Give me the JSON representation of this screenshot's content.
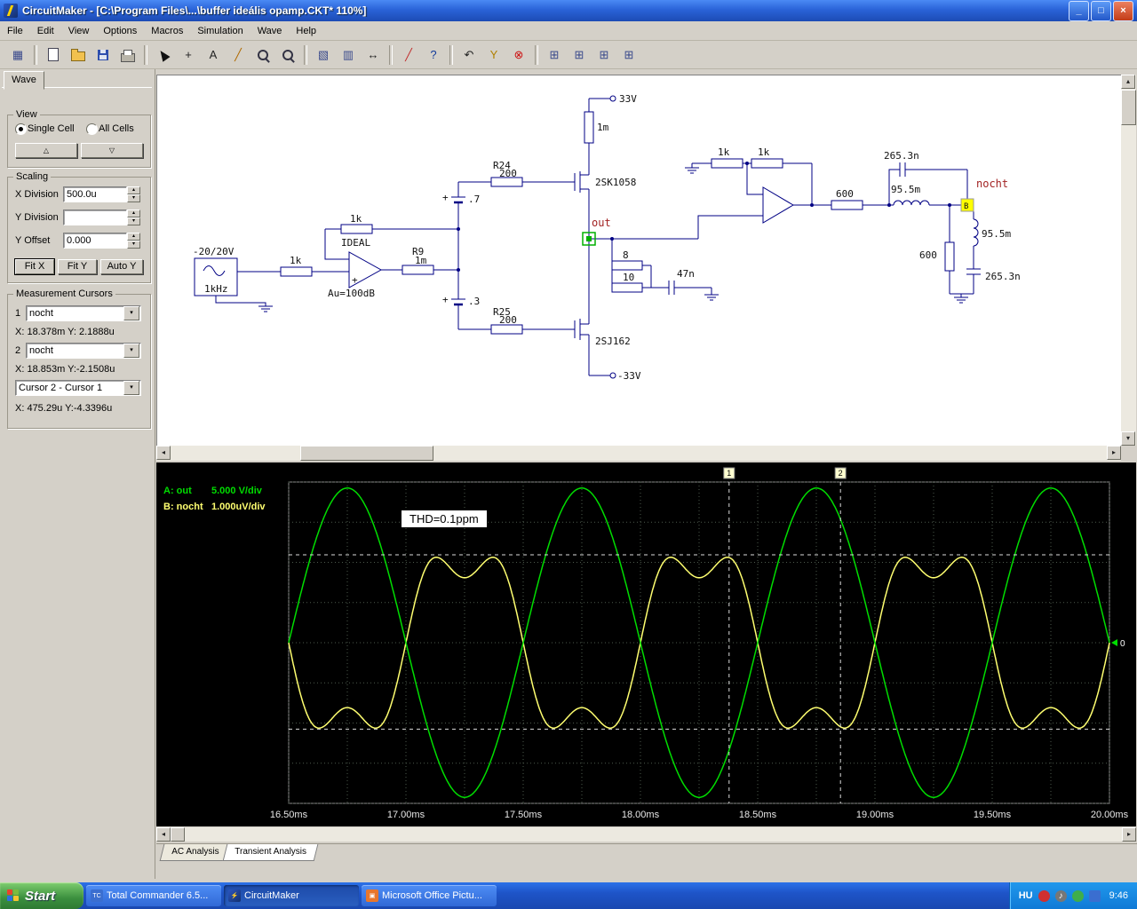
{
  "window": {
    "title": "CircuitMaker - [C:\\Program Files\\...\\buffer ideális opamp.CKT* 110%]",
    "controls": {
      "minimize": "_",
      "maximize": "□",
      "close": "×"
    },
    "menus": [
      "File",
      "Edit",
      "View",
      "Options",
      "Macros",
      "Simulation",
      "Wave",
      "Help"
    ]
  },
  "toolbar": {
    "buttons": [
      {
        "name": "pcb-board",
        "glyph": "▦",
        "color": "#3a4a8c"
      },
      {
        "type": "sep"
      },
      {
        "name": "new-file",
        "cls": "ic-page"
      },
      {
        "name": "open-file",
        "cls": "ic-folder"
      },
      {
        "name": "save-file",
        "cls": "ic-save"
      },
      {
        "name": "print",
        "cls": "ic-print"
      },
      {
        "type": "sep"
      },
      {
        "name": "select-tool",
        "cls": "ic-cursorarrow"
      },
      {
        "name": "add-part",
        "glyph": "+",
        "color": "#222"
      },
      {
        "name": "text-tool",
        "glyph": "A",
        "color": "#222"
      },
      {
        "name": "probe-tool",
        "glyph": "╱",
        "color": "#b06a00"
      },
      {
        "name": "zoom-in",
        "cls": "ic-lens"
      },
      {
        "name": "zoom-tool",
        "cls": "ic-lens"
      },
      {
        "type": "sep"
      },
      {
        "name": "search-part",
        "glyph": "▧",
        "color": "#3a4a8c"
      },
      {
        "name": "device-view",
        "glyph": "▥",
        "color": "#3a4a8c"
      },
      {
        "name": "fit-view",
        "glyph": "↔",
        "color": "#222"
      },
      {
        "type": "sep"
      },
      {
        "name": "run-probe",
        "glyph": "╱",
        "color": "#c03030"
      },
      {
        "name": "help",
        "glyph": "?",
        "color": "#103a9a"
      },
      {
        "type": "sep"
      },
      {
        "name": "undo",
        "glyph": "↶",
        "color": "#222"
      },
      {
        "name": "wizard",
        "glyph": "Y",
        "color": "#b08000"
      },
      {
        "name": "stop-simulation",
        "glyph": "⊗",
        "color": "#cc1111"
      },
      {
        "type": "sep"
      },
      {
        "name": "scope-display-1",
        "glyph": "⊞",
        "color": "#3a4a8c"
      },
      {
        "name": "scope-display-2",
        "glyph": "⊞",
        "color": "#3a4a8c"
      },
      {
        "name": "scope-display-3",
        "glyph": "⊞",
        "color": "#3a4a8c"
      },
      {
        "name": "scope-display-4",
        "glyph": "⊞",
        "color": "#3a4a8c"
      }
    ]
  },
  "glyphs": {
    "spin_up": "▴",
    "spin_down": "▾",
    "combo_arrow": "▾",
    "scroll_up": "▴",
    "scroll_down": "▾",
    "scroll_left": "◂",
    "scroll_right": "▸"
  },
  "panel": {
    "tab": "Wave",
    "view": {
      "title": "View",
      "options": [
        {
          "label": "Single Cell",
          "selected": true
        },
        {
          "label": "All Cells",
          "selected": false
        }
      ],
      "up_glyph": "△",
      "down_glyph": "▽"
    },
    "scaling": {
      "title": "Scaling",
      "x_division_label": "X Division",
      "x_division_value": "500.0u",
      "y_division_label": "Y Division",
      "y_division_value": "",
      "y_offset_label": "Y Offset",
      "y_offset_value": "0.000",
      "fit_x": "Fit X",
      "fit_y": "Fit Y",
      "auto_y": "Auto Y"
    },
    "cursors": {
      "title": "Measurement Cursors",
      "cursor1_num": "1",
      "cursor1_value": "nocht",
      "cursor1_readout": "X: 18.378m Y: 2.1888u",
      "cursor2_num": "2",
      "cursor2_value": "nocht",
      "cursor2_readout": "X: 18.853m Y:-2.1508u",
      "diff_value": "Cursor 2 - Cursor 1",
      "diff_readout": "X: 475.29u Y:-4.3396u"
    }
  },
  "schematic": {
    "labels": {
      "v_pos": "33V",
      "r_drain": "1m",
      "q1": "2SK1058",
      "r24_name": "R24",
      "r24_val": "200",
      "bias1_plus": "+",
      "bias1_val": ".7",
      "bias2_plus": "+",
      "bias2_val": ".3",
      "fb_r": "1k",
      "ideal": "IDEAL",
      "op1_plus": "+",
      "gain": "Au=100dB",
      "src_v": "-20/20V",
      "src_f": "1kHz",
      "r_in": "1k",
      "r9_name": "R9",
      "r9_val": "1m",
      "out": "out",
      "r25_name": "R25",
      "r25_val": "200",
      "q2": "2SJ162",
      "v_neg": "-33V",
      "r8": "8",
      "r10": "10",
      "c_out": "47n",
      "r_fb1": "1k",
      "r_fb2": "1k",
      "r_series": "600",
      "l_series": "95.5m",
      "c_series": "265.3n",
      "nocht": "nocht",
      "b_marker": "B",
      "r_load": "600",
      "l_load": "95.5m",
      "c_load": "265.3n"
    }
  },
  "chart_data": {
    "type": "line",
    "x_unit": "ms",
    "x_range": [
      16.5,
      20.0
    ],
    "x_ticks": [
      "16.50ms",
      "17.00ms",
      "17.50ms",
      "18.00ms",
      "18.50ms",
      "19.00ms",
      "19.50ms",
      "20.00ms"
    ],
    "divisions_y": 8,
    "grid": true,
    "background": "#000000",
    "series": [
      {
        "name": "A: out",
        "scale_per_div": "5.000 V/div",
        "color": "#00dd00",
        "waveform": "sine",
        "frequency_hz": 1000,
        "amplitude_div": 3.85,
        "phase_origin_ms": 16.5
      },
      {
        "name": "B: nocht",
        "scale_per_div": "1.000uV/div",
        "color": "#ffff70",
        "waveform": "distortion-residual",
        "frequency_hz": 1000,
        "amplitude_div": 2.31,
        "h3_ratio": 0.3,
        "inverted": true
      }
    ],
    "cursors": [
      {
        "label": "1",
        "x_ms": 18.378,
        "y_div": 2.1888
      },
      {
        "label": "2",
        "x_ms": 18.853,
        "y_div": -2.1508
      }
    ],
    "annotation": "THD=0.1ppm",
    "zero_marker": "0"
  },
  "tabs": [
    {
      "label": "AC Analysis",
      "active": false
    },
    {
      "label": "Transient Analysis",
      "active": true
    }
  ],
  "taskbar": {
    "start": "Start",
    "buttons": [
      {
        "label": "Total Commander 6.5...",
        "active": false
      },
      {
        "label": "CircuitMaker",
        "active": true
      },
      {
        "label": "Microsoft Office Pictu...",
        "active": false
      }
    ],
    "tray": {
      "lang": "HU",
      "time": "9:46"
    }
  }
}
